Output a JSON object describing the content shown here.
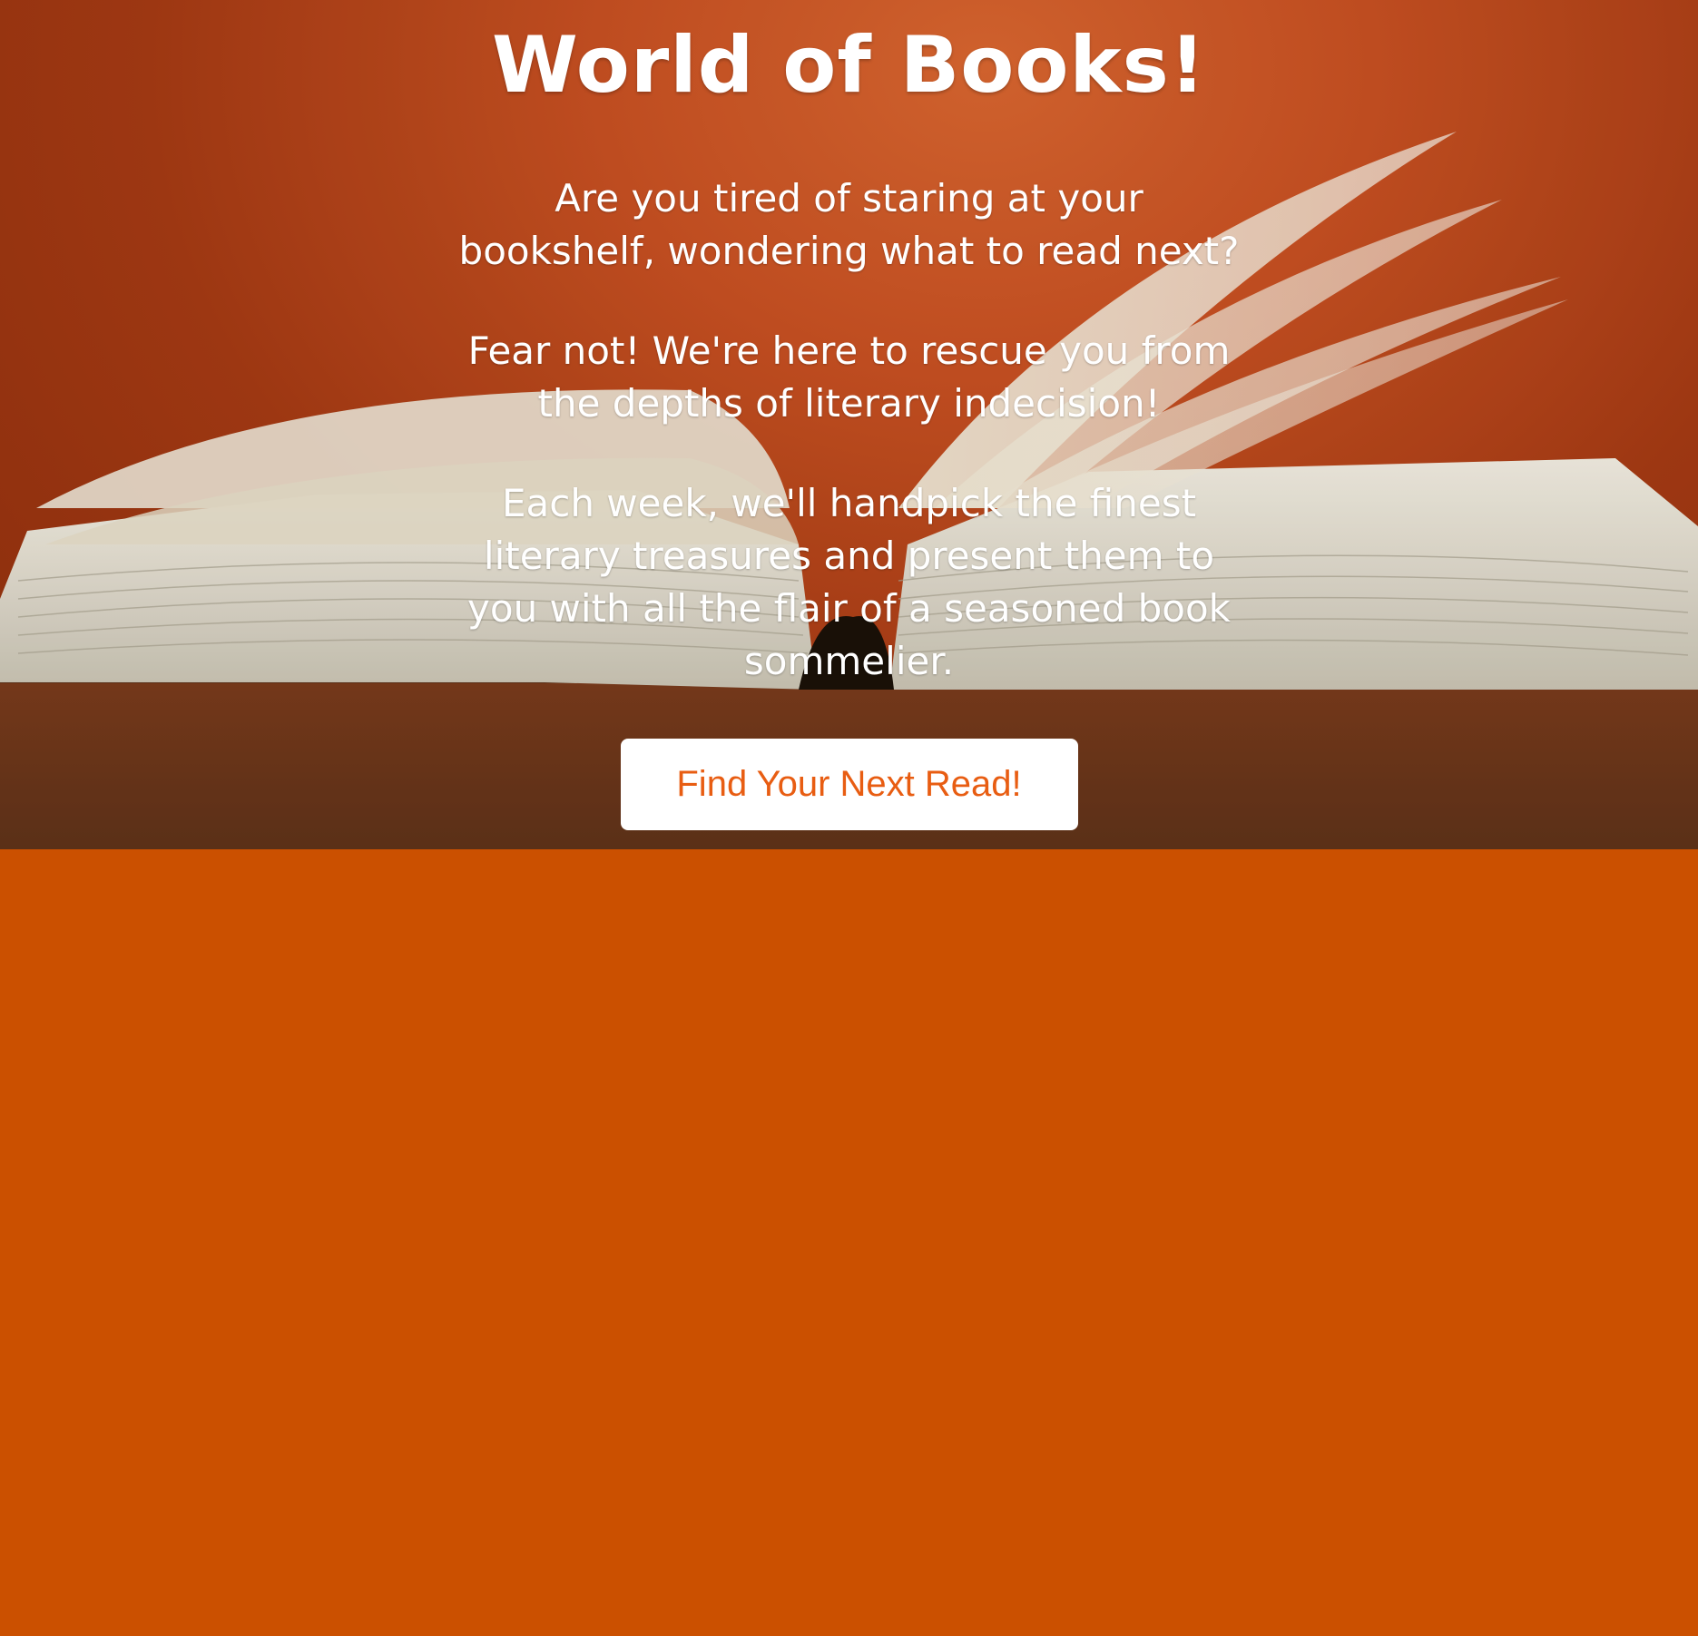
{
  "hero": {
    "title": "World of Books!",
    "paragraphs": [
      "Are you tired of staring at your bookshelf, wondering what to read next?",
      "Fear not! We're here to rescue you from the depths of literary indecision!",
      "Each week, we'll handpick the finest literary treasures and present them to you with all the flair of a seasoned book sommelier."
    ],
    "cta_label": "Find Your Next Read!"
  },
  "colors": {
    "page_background": "#cb5000",
    "hero_background": "#c65022",
    "cta_text": "#e85d12",
    "text": "#ffffff"
  }
}
